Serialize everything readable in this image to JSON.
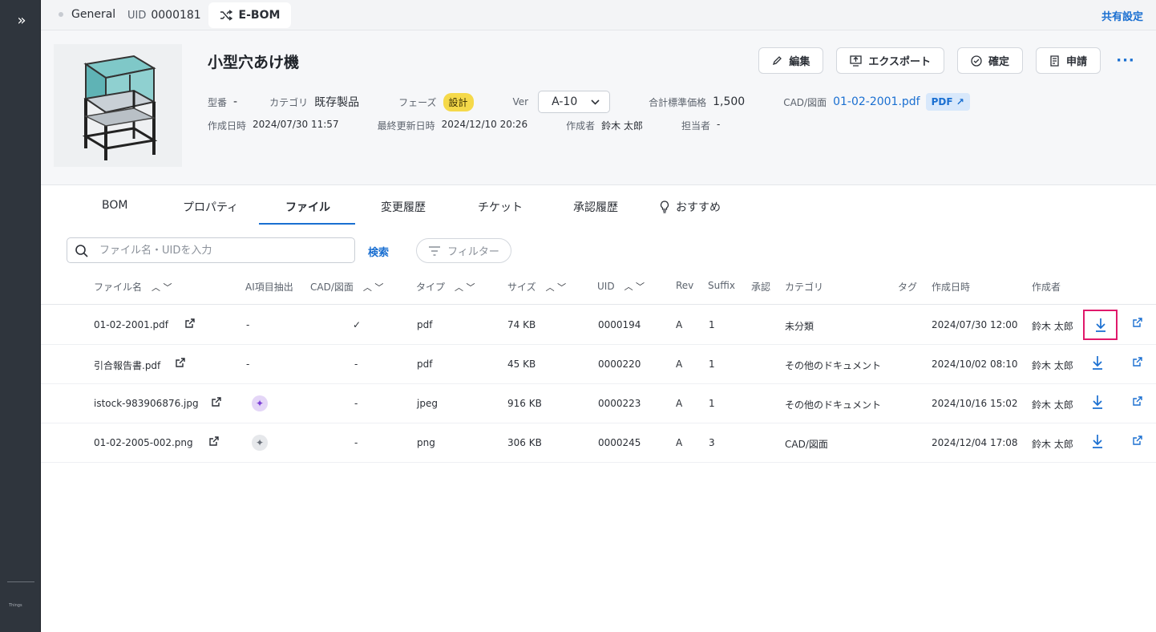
{
  "topbar": {
    "general": "General",
    "uid_label": "UID",
    "uid_value": "0000181",
    "tab_label": "E-BOM",
    "share_label": "共有設定"
  },
  "sidebar": {
    "logo_text": "Things"
  },
  "product": {
    "title": "小型穴あけ機",
    "actions": {
      "edit": "編集",
      "export": "エクスポート",
      "confirm": "確定",
      "apply": "申請",
      "more": "···"
    },
    "meta": {
      "model_label": "型番",
      "model_value": "-",
      "category_label": "カテゴリ",
      "category_value": "既存製品",
      "phase_label": "フェーズ",
      "phase_value": "設計",
      "ver_label": "Ver",
      "ver_value": "A-10",
      "price_label": "合計標準価格",
      "price_value": "1,500",
      "cad_label": "CAD/図面",
      "cad_value": "01-02-2001.pdf",
      "pdf_badge": "PDF",
      "created_label": "作成日時",
      "created_value": "2024/07/30 11:57",
      "updated_label": "最終更新日時",
      "updated_value": "2024/12/10 20:26",
      "author_label": "作成者",
      "author_value": "鈴木 太郎",
      "assignee_label": "担当者",
      "assignee_value": "-"
    }
  },
  "tabs": [
    "BOM",
    "プロパティ",
    "ファイル",
    "変更履歴",
    "チケット",
    "承認履歴",
    "おすすめ"
  ],
  "active_tab": "ファイル",
  "search": {
    "placeholder": "ファイル名・UIDを入力",
    "button": "検索",
    "filter": "フィルター"
  },
  "table": {
    "headers": {
      "name": "ファイル名",
      "ai": "AI項目抽出",
      "cad": "CAD/図面",
      "type": "タイプ",
      "size": "サイズ",
      "uid": "UID",
      "rev": "Rev",
      "suffix": "Suffix",
      "approval": "承認",
      "category": "カテゴリ",
      "tag": "タグ",
      "created": "作成日時",
      "author": "作成者"
    },
    "rows": [
      {
        "name": "01-02-2001.pdf",
        "ai": "-",
        "cad": "✓",
        "type": "pdf",
        "size": "74 KB",
        "uid": "0000194",
        "rev": "A",
        "suffix": "1",
        "category": "未分類",
        "created": "2024/07/30 12:00",
        "author": "鈴木 太郎"
      },
      {
        "name": "引合報告書.pdf",
        "ai": "-",
        "cad": "-",
        "type": "pdf",
        "size": "45 KB",
        "uid": "0000220",
        "rev": "A",
        "suffix": "1",
        "category": "その他のドキュメント",
        "created": "2024/10/02 08:10",
        "author": "鈴木 太郎"
      },
      {
        "name": "istock-983906876.jpg",
        "ai": "sparkle-active",
        "cad": "-",
        "type": "jpeg",
        "size": "916 KB",
        "uid": "0000223",
        "rev": "A",
        "suffix": "1",
        "category": "その他のドキュメント",
        "created": "2024/10/16 15:02",
        "author": "鈴木 太郎"
      },
      {
        "name": "01-02-2005-002.png",
        "ai": "sparkle-inactive",
        "cad": "-",
        "type": "png",
        "size": "306 KB",
        "uid": "0000245",
        "rev": "A",
        "suffix": "3",
        "category": "CAD/図面",
        "created": "2024/12/04 17:08",
        "author": "鈴木 太郎"
      }
    ]
  },
  "colors": {
    "accent": "#1a6fd1",
    "sidebar": "#2f353d",
    "highlight": "#e0196b",
    "badge": "#f5d94a"
  }
}
